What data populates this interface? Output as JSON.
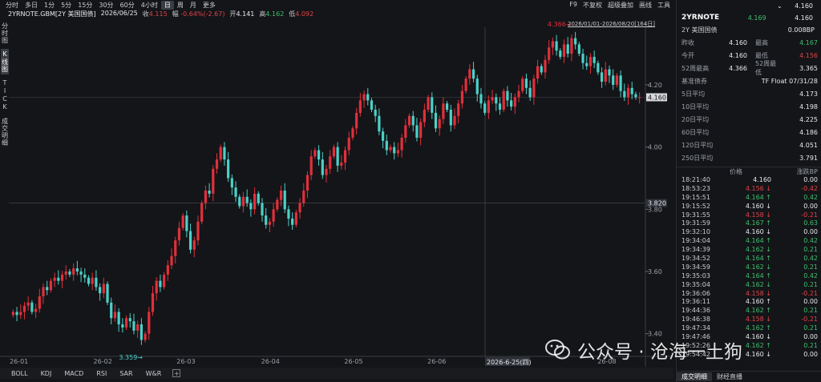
{
  "toolbar": {
    "timeframes": [
      "分时",
      "多日",
      "1分",
      "5分",
      "15分",
      "30分",
      "60分",
      "4小时",
      "日",
      "周",
      "月",
      "更多"
    ],
    "active": "日",
    "right": [
      "F9",
      "不复权",
      "超级叠加",
      "画线",
      "工具"
    ]
  },
  "info": {
    "symbol": "2YRNOTE.GBM[2Y 美国国债]",
    "date": "2026/06/25",
    "close_label": "收",
    "close": "4.115",
    "change_label": "幅",
    "change": "-0.64%(-2.67)",
    "open_label": "开",
    "open": "4.141",
    "high_label": "高",
    "high": "4.162",
    "low_label": "低",
    "low": "4.092"
  },
  "left_tabs": [
    "分时图",
    "K线图",
    "TICK",
    "成交明细"
  ],
  "left_tab_active": "K线图",
  "range_label": "2026/01/01-2026/08/20[164日]",
  "chart_data": {
    "type": "candlestick",
    "x_ticks": [
      "26-01",
      "26-02",
      "26-03",
      "26-04",
      "26-05",
      "26-06",
      "26-08"
    ],
    "y_ticks": [
      "4.20",
      "4.00",
      "3.80",
      "3.60",
      "3.40"
    ],
    "ylim": [
      3.34,
      4.38
    ],
    "max_label": "4.366",
    "min_label": "3.359",
    "last_price_tag": "4.160",
    "crosshair_price": "3.820",
    "crosshair_date": "2026-6-25(四)",
    "colors": {
      "up": "#e0303c",
      "down": "#4bd1c9"
    },
    "closes": [
      3.47,
      3.46,
      3.47,
      3.49,
      3.5,
      3.47,
      3.48,
      3.52,
      3.55,
      3.54,
      3.57,
      3.58,
      3.57,
      3.59,
      3.6,
      3.59,
      3.61,
      3.6,
      3.59,
      3.58,
      3.56,
      3.58,
      3.55,
      3.53,
      3.56,
      3.5,
      3.45,
      3.47,
      3.43,
      3.42,
      3.45,
      3.44,
      3.41,
      3.43,
      3.38,
      3.4,
      3.47,
      3.53,
      3.57,
      3.55,
      3.59,
      3.62,
      3.65,
      3.7,
      3.74,
      3.78,
      3.73,
      3.67,
      3.7,
      3.76,
      3.82,
      3.86,
      3.85,
      3.93,
      3.96,
      4.0,
      3.96,
      3.9,
      3.87,
      3.84,
      3.81,
      3.84,
      3.82,
      3.8,
      3.85,
      3.82,
      3.78,
      3.75,
      3.76,
      3.8,
      3.83,
      3.86,
      3.8,
      3.77,
      3.75,
      3.79,
      3.82,
      3.86,
      3.91,
      3.97,
      3.99,
      3.96,
      3.91,
      3.93,
      3.97,
      4.0,
      3.94,
      3.95,
      3.99,
      4.03,
      4.06,
      4.11,
      4.15,
      4.17,
      4.15,
      4.12,
      4.1,
      4.05,
      4.02,
      3.99,
      4.0,
      3.98,
      3.99,
      4.03,
      4.07,
      4.1,
      4.07,
      4.03,
      4.08,
      4.12,
      4.16,
      4.11,
      4.06,
      4.09,
      4.14,
      4.12,
      4.07,
      4.1,
      4.14,
      4.18,
      4.22,
      4.25,
      4.22,
      4.17,
      4.14,
      4.11,
      4.15,
      4.16,
      4.14,
      4.12,
      4.18,
      4.15,
      4.13,
      4.16,
      4.18,
      4.22,
      4.19,
      4.16,
      4.22,
      4.26,
      4.24,
      4.28,
      4.32,
      4.34,
      4.31,
      4.29,
      4.33,
      4.3,
      4.35,
      4.33,
      4.3,
      4.27,
      4.26,
      4.29,
      4.27,
      4.24,
      4.21,
      4.25,
      4.23,
      4.2,
      4.23,
      4.18,
      4.16,
      4.19,
      4.17,
      4.16,
      4.16
    ]
  },
  "indicators": [
    "BOLL",
    "KDJ",
    "MACD",
    "RSI",
    "SAR",
    "W&R"
  ],
  "panel": {
    "top_price": "4.160",
    "code": "2YRNOTE",
    "price": "4.169",
    "price_right": "4.160",
    "name": "2Y 美国国债",
    "bp": "0.008BP",
    "rows": [
      {
        "k": "昨收",
        "v": "4.160",
        "k2": "最高",
        "v2": "4.167",
        "c2": "green"
      },
      {
        "k": "今开",
        "v": "4.160",
        "k2": "最低",
        "v2": "4.156",
        "c2": "red"
      },
      {
        "k": "52周最高",
        "v": "4.366",
        "k2": "52周最低",
        "v2": "3.365",
        "c2": "white"
      }
    ],
    "bond_label": "基准债券",
    "bond_value": "TF Float 07/31/28",
    "averages": [
      {
        "k": "5日平均",
        "v": "4.173"
      },
      {
        "k": "10日平均",
        "v": "4.198"
      },
      {
        "k": "20日平均",
        "v": "4.225"
      },
      {
        "k": "60日平均",
        "v": "4.186"
      },
      {
        "k": "120日平均",
        "v": "4.051"
      },
      {
        "k": "250日平均",
        "v": "3.791"
      }
    ],
    "tick_header": [
      "价格",
      "涨跌BP"
    ],
    "ticks": [
      {
        "t": "18:21:40",
        "p": "4.160",
        "c": "0.00",
        "a": "",
        "col": "white"
      },
      {
        "t": "18:53:23",
        "p": "4.156",
        "c": "-0.42",
        "a": "↓",
        "col": "red"
      },
      {
        "t": "19:15:51",
        "p": "4.164",
        "c": "0.42",
        "a": "↑",
        "col": "green"
      },
      {
        "t": "19:15:52",
        "p": "4.160",
        "c": "0.00",
        "a": "↓",
        "col": "white"
      },
      {
        "t": "19:31:55",
        "p": "4.158",
        "c": "-0.21",
        "a": "↓",
        "col": "red"
      },
      {
        "t": "19:31:59",
        "p": "4.167",
        "c": "0.63",
        "a": "↑",
        "col": "green"
      },
      {
        "t": "19:32:10",
        "p": "4.160",
        "c": "0.00",
        "a": "↓",
        "col": "white"
      },
      {
        "t": "19:34:04",
        "p": "4.164",
        "c": "0.42",
        "a": "↑",
        "col": "green"
      },
      {
        "t": "19:34:39",
        "p": "4.162",
        "c": "0.21",
        "a": "↓",
        "col": "green"
      },
      {
        "t": "19:34:52",
        "p": "4.164",
        "c": "0.42",
        "a": "↑",
        "col": "green"
      },
      {
        "t": "19:34:59",
        "p": "4.162",
        "c": "0.21",
        "a": "↓",
        "col": "green"
      },
      {
        "t": "19:35:03",
        "p": "4.164",
        "c": "0.42",
        "a": "↑",
        "col": "green"
      },
      {
        "t": "19:35:04",
        "p": "4.162",
        "c": "0.21",
        "a": "↓",
        "col": "green"
      },
      {
        "t": "19:36:06",
        "p": "4.158",
        "c": "-0.21",
        "a": "↓",
        "col": "red"
      },
      {
        "t": "19:36:11",
        "p": "4.160",
        "c": "0.00",
        "a": "↑",
        "col": "white"
      },
      {
        "t": "19:44:36",
        "p": "4.162",
        "c": "0.21",
        "a": "↑",
        "col": "green"
      },
      {
        "t": "19:46:38",
        "p": "4.158",
        "c": "-0.21",
        "a": "↓",
        "col": "red"
      },
      {
        "t": "19:47:34",
        "p": "4.162",
        "c": "0.21",
        "a": "↑",
        "col": "green"
      },
      {
        "t": "19:47:46",
        "p": "4.160",
        "c": "0.00",
        "a": "↓",
        "col": "white"
      },
      {
        "t": "19:52:26",
        "p": "4.162",
        "c": "0.21",
        "a": "↑",
        "col": "green"
      },
      {
        "t": "19:54:42",
        "p": "4.160",
        "c": "0.00",
        "a": "↓",
        "col": "white"
      }
    ],
    "tabs": [
      "成交明细",
      "财经直播"
    ],
    "tab_active": "成交明细"
  },
  "watermark": "公众号 · 沧海一土狗"
}
